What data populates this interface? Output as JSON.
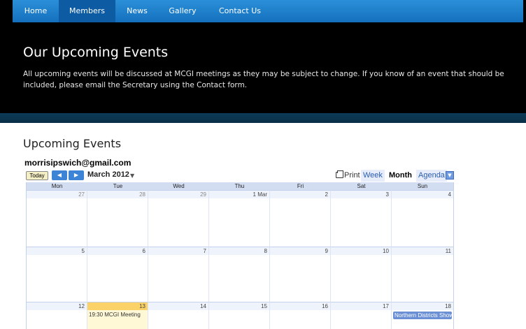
{
  "nav": {
    "items": [
      "Home",
      "Members",
      "News",
      "Gallery",
      "Contact Us"
    ],
    "active": "Members"
  },
  "hero": {
    "title": "Our Upcoming Events",
    "text": "All upcoming events will be discussed at MCGI meetings as they may be subject to change. If you know of an event that should be included, please email the Secretary using the Contact form."
  },
  "main": {
    "section_title": "Upcoming Events",
    "calendar_email": "morrisipswich@gmail.com"
  },
  "calendar": {
    "today_label": "Today",
    "prev_label": "◀",
    "next_label": "▶",
    "month_label": "March 2012",
    "month_dropdown": "▼",
    "print_label": "Print",
    "tabs": [
      "Week",
      "Month",
      "Agenda"
    ],
    "active_tab": "Month",
    "agenda_dropdown": "▼",
    "day_headers": [
      "Mon",
      "Tue",
      "Wed",
      "Thu",
      "Fri",
      "Sat",
      "Sun"
    ],
    "weeks": [
      [
        "27",
        "28",
        "29",
        "1 Mar",
        "2",
        "3",
        "4"
      ],
      [
        "5",
        "6",
        "7",
        "8",
        "9",
        "10",
        "11"
      ],
      [
        "12",
        "13",
        "14",
        "15",
        "16",
        "17",
        "18"
      ]
    ],
    "events": {
      "tue_13": "19:30 MCGI Meeting",
      "sun_18": "Northern Districts Show"
    },
    "colors": {
      "accent": "#3d84d6",
      "today_strip": "#fad267",
      "event_chip": "#6b8fd4"
    }
  }
}
